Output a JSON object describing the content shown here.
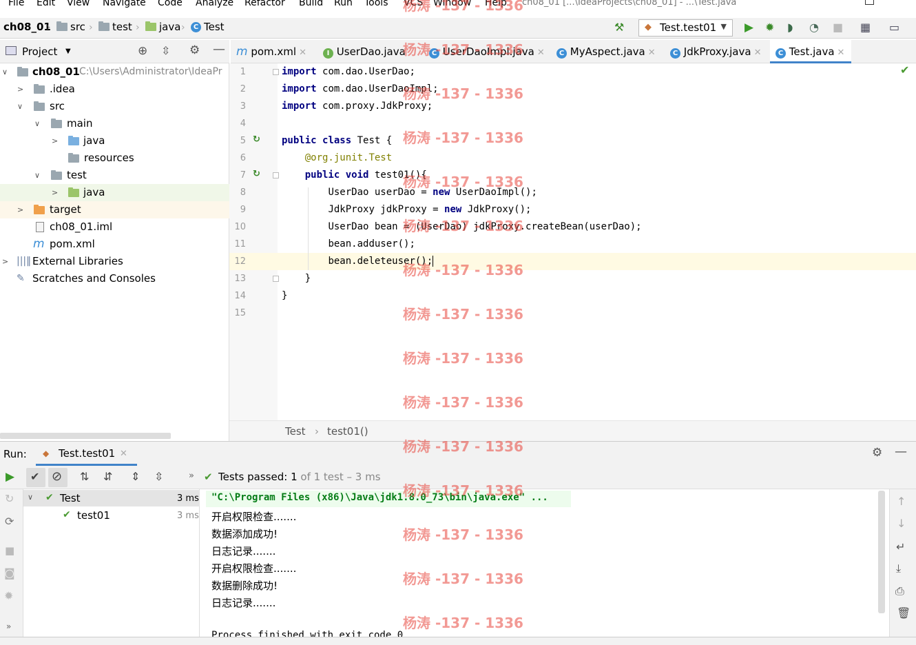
{
  "menu": [
    "File",
    "Edit",
    "View",
    "Navigate",
    "Code",
    "Analyze",
    "Refactor",
    "Build",
    "Run",
    "Tools",
    "VCS",
    "Window",
    "Help"
  ],
  "window_title": "ch08_01 [...\\IdeaProjects\\ch08_01] - ...\\Test.java",
  "navbar": {
    "project": "ch08_01",
    "crumbs": [
      "src",
      "test",
      "java",
      "Test"
    ],
    "run_config": "Test.test01"
  },
  "project_panel": {
    "title": "Project",
    "tree": [
      {
        "label": "ch08_01",
        "path": "C:\\Users\\Administrator\\IdeaPr"
      },
      {
        "label": ".idea"
      },
      {
        "label": "src"
      },
      {
        "label": "main"
      },
      {
        "label": "java"
      },
      {
        "label": "resources"
      },
      {
        "label": "test"
      },
      {
        "label": "java"
      },
      {
        "label": "target"
      },
      {
        "label": "ch08_01.iml"
      },
      {
        "label": "pom.xml"
      },
      {
        "label": "External Libraries"
      },
      {
        "label": "Scratches and Consoles"
      }
    ]
  },
  "tabs": [
    {
      "label": "pom.xml",
      "icon": "m"
    },
    {
      "label": "UserDao.java",
      "icon": "I"
    },
    {
      "label": "UserDaoImpl.java",
      "icon": "C"
    },
    {
      "label": "MyAspect.java",
      "icon": "C"
    },
    {
      "label": "JdkProxy.java",
      "icon": "C"
    },
    {
      "label": "Test.java",
      "icon": "C"
    }
  ],
  "editor": {
    "line_numbers": [
      "1",
      "2",
      "3",
      "4",
      "5",
      "6",
      "7",
      "8",
      "9",
      "10",
      "11",
      "12",
      "13",
      "14",
      "15"
    ],
    "lines": {
      "l1": "com.dao.UserDao;",
      "l2": "com.dao.UserDaoImpl;",
      "l3": "com.proxy.JdkProxy;",
      "l5": "Test {",
      "l6a": "@org.junit.",
      "l6b": "Test",
      "l7": "test01(){",
      "l8a": "UserDao userDao = ",
      "l8b": "UserDaoImpl();",
      "l9a": "JdkProxy jdkProxy = ",
      "l9b": "JdkProxy();",
      "l10": "UserDao bean = (UserDao) jdkProxy.createBean(userDao);",
      "l11": "bean.adduser();",
      "l12": "bean.deleteuser();",
      "l13": "}",
      "l14": "}"
    },
    "keywords": {
      "import": "import",
      "public": "public",
      "class": "class",
      "void": "void",
      "new": "new"
    },
    "breadcrumb": [
      "Test",
      "test01()"
    ]
  },
  "run": {
    "label": "Run:",
    "tab": "Test.test01",
    "status_prefix": "Tests passed:",
    "status_count": "1",
    "status_rest": "of 1 test – 3 ms",
    "tree": [
      {
        "label": "Test",
        "time": "3 ms"
      },
      {
        "label": "test01",
        "time": "3 ms"
      }
    ],
    "console": [
      "\"C:\\Program Files (x86)\\Java\\jdk1.8.0_73\\bin\\java.exe\" ...",
      "开启权限检查.......",
      "数据添加成功!",
      "日志记录.......",
      "开启权限检查.......",
      "数据删除成功!",
      "日志记录.......",
      "",
      "Process finished with exit code 0"
    ]
  },
  "watermark": "杨涛 -137 - 1336"
}
